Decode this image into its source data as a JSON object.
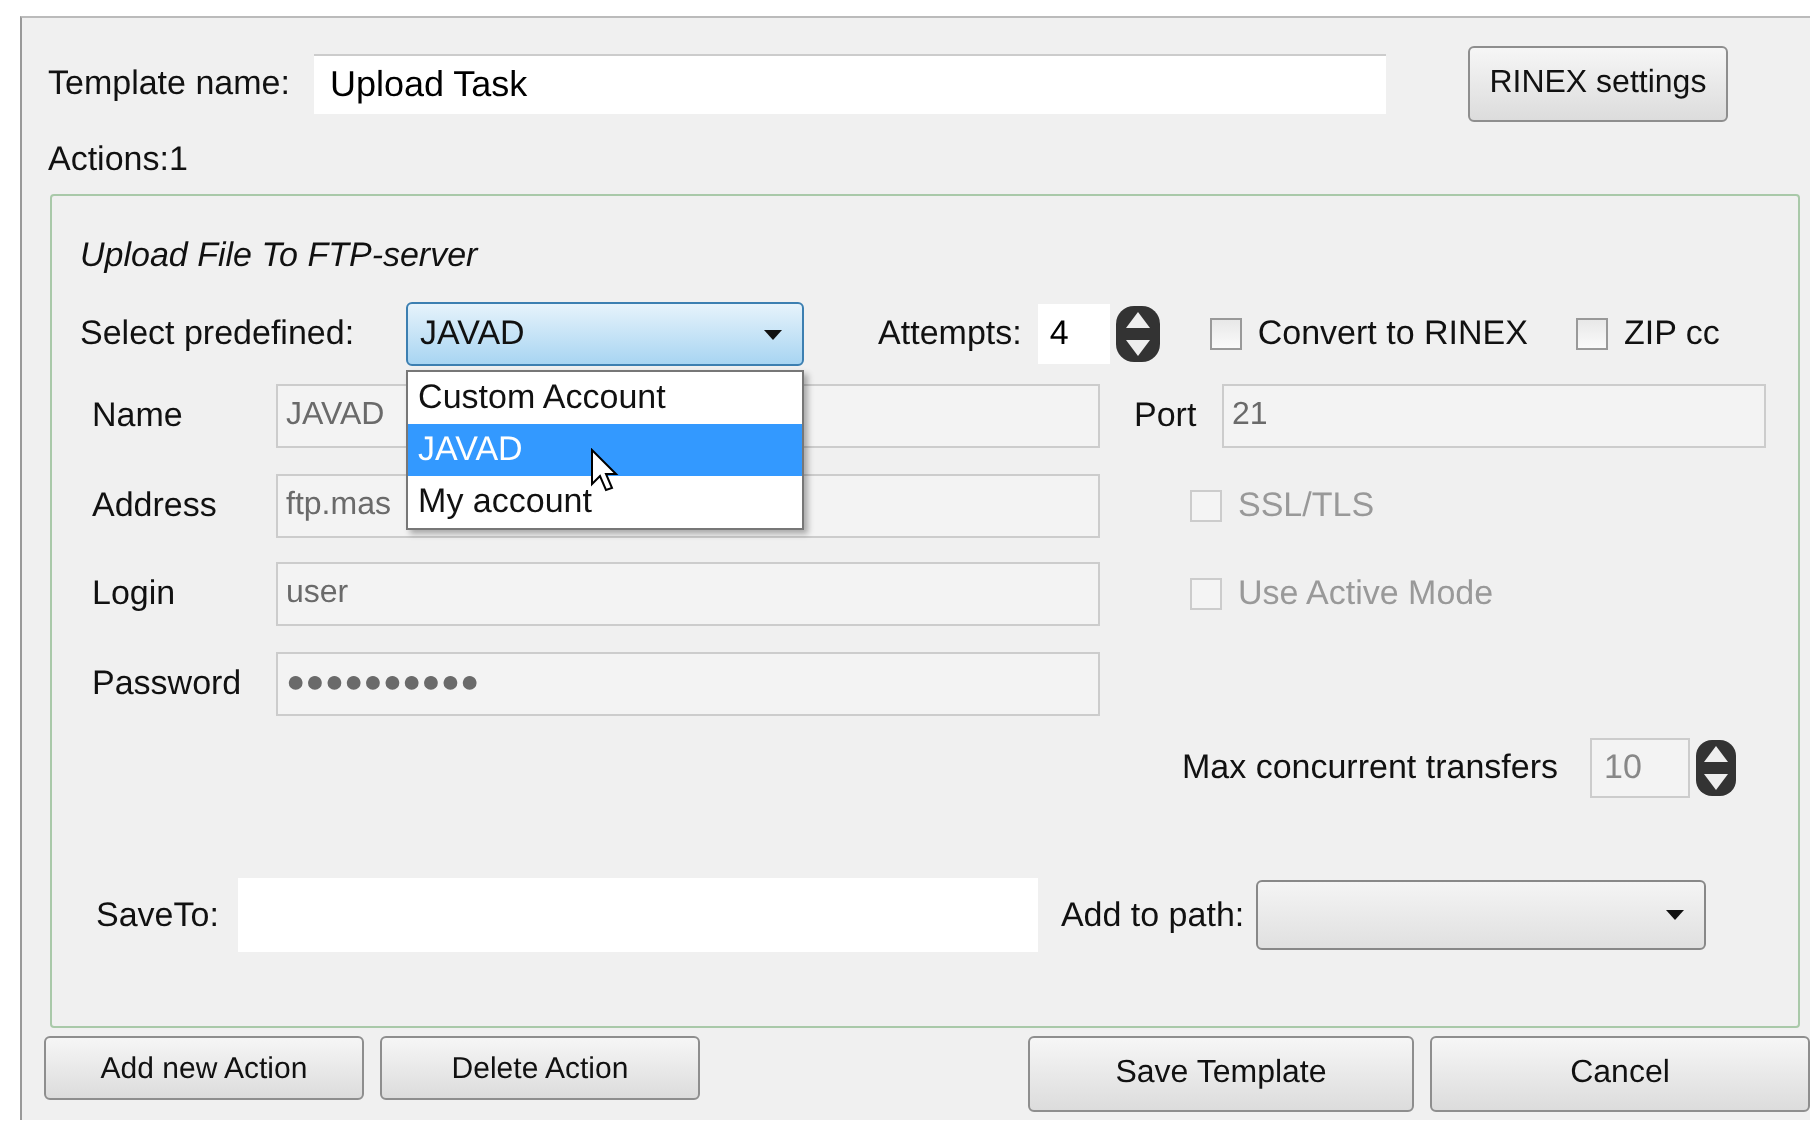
{
  "template_name": {
    "label": "Template name:",
    "value": "Upload Task"
  },
  "rinex_button": "RINEX settings",
  "actions_count": "Actions:1",
  "action": {
    "title": "Upload File To FTP-server",
    "predefined": {
      "label": "Select predefined:",
      "value": "JAVAD",
      "expanded": true,
      "options": [
        {
          "label": "Custom Account",
          "selected": false
        },
        {
          "label": "JAVAD",
          "selected": true
        },
        {
          "label": "My account",
          "selected": false
        }
      ]
    },
    "attempts": {
      "label": "Attempts:",
      "value": "4"
    },
    "options": [
      {
        "label": "Convert to RINEX",
        "checked": false,
        "disabled": false
      },
      {
        "label": "ZIP cc",
        "checked": false,
        "disabled": false
      }
    ],
    "fields": [
      {
        "label": "Name",
        "value": "JAVAD"
      },
      {
        "label": "Address",
        "value": "ftp.mas"
      },
      {
        "label": "Login",
        "value": "user"
      },
      {
        "label": "Password",
        "value": "●●●●●●●●●●"
      }
    ],
    "port": {
      "label": "Port",
      "value": "21"
    },
    "connection_options": [
      {
        "label": "SSL/TLS",
        "checked": false,
        "disabled": true
      },
      {
        "label": "Use Active Mode",
        "checked": false,
        "disabled": true
      }
    ],
    "max_transfers": {
      "label": "Max concurrent transfers",
      "value": "10"
    },
    "save_to": {
      "label": "SaveTo:"
    },
    "add_to_path": {
      "label": "Add to path:"
    }
  },
  "buttons": [
    {
      "label": "Add new Action",
      "kind": "small"
    },
    {
      "label": "Delete Action",
      "kind": "small"
    },
    {
      "label": "Save Template",
      "kind": "large"
    },
    {
      "label": "Cancel",
      "kind": "large"
    }
  ]
}
